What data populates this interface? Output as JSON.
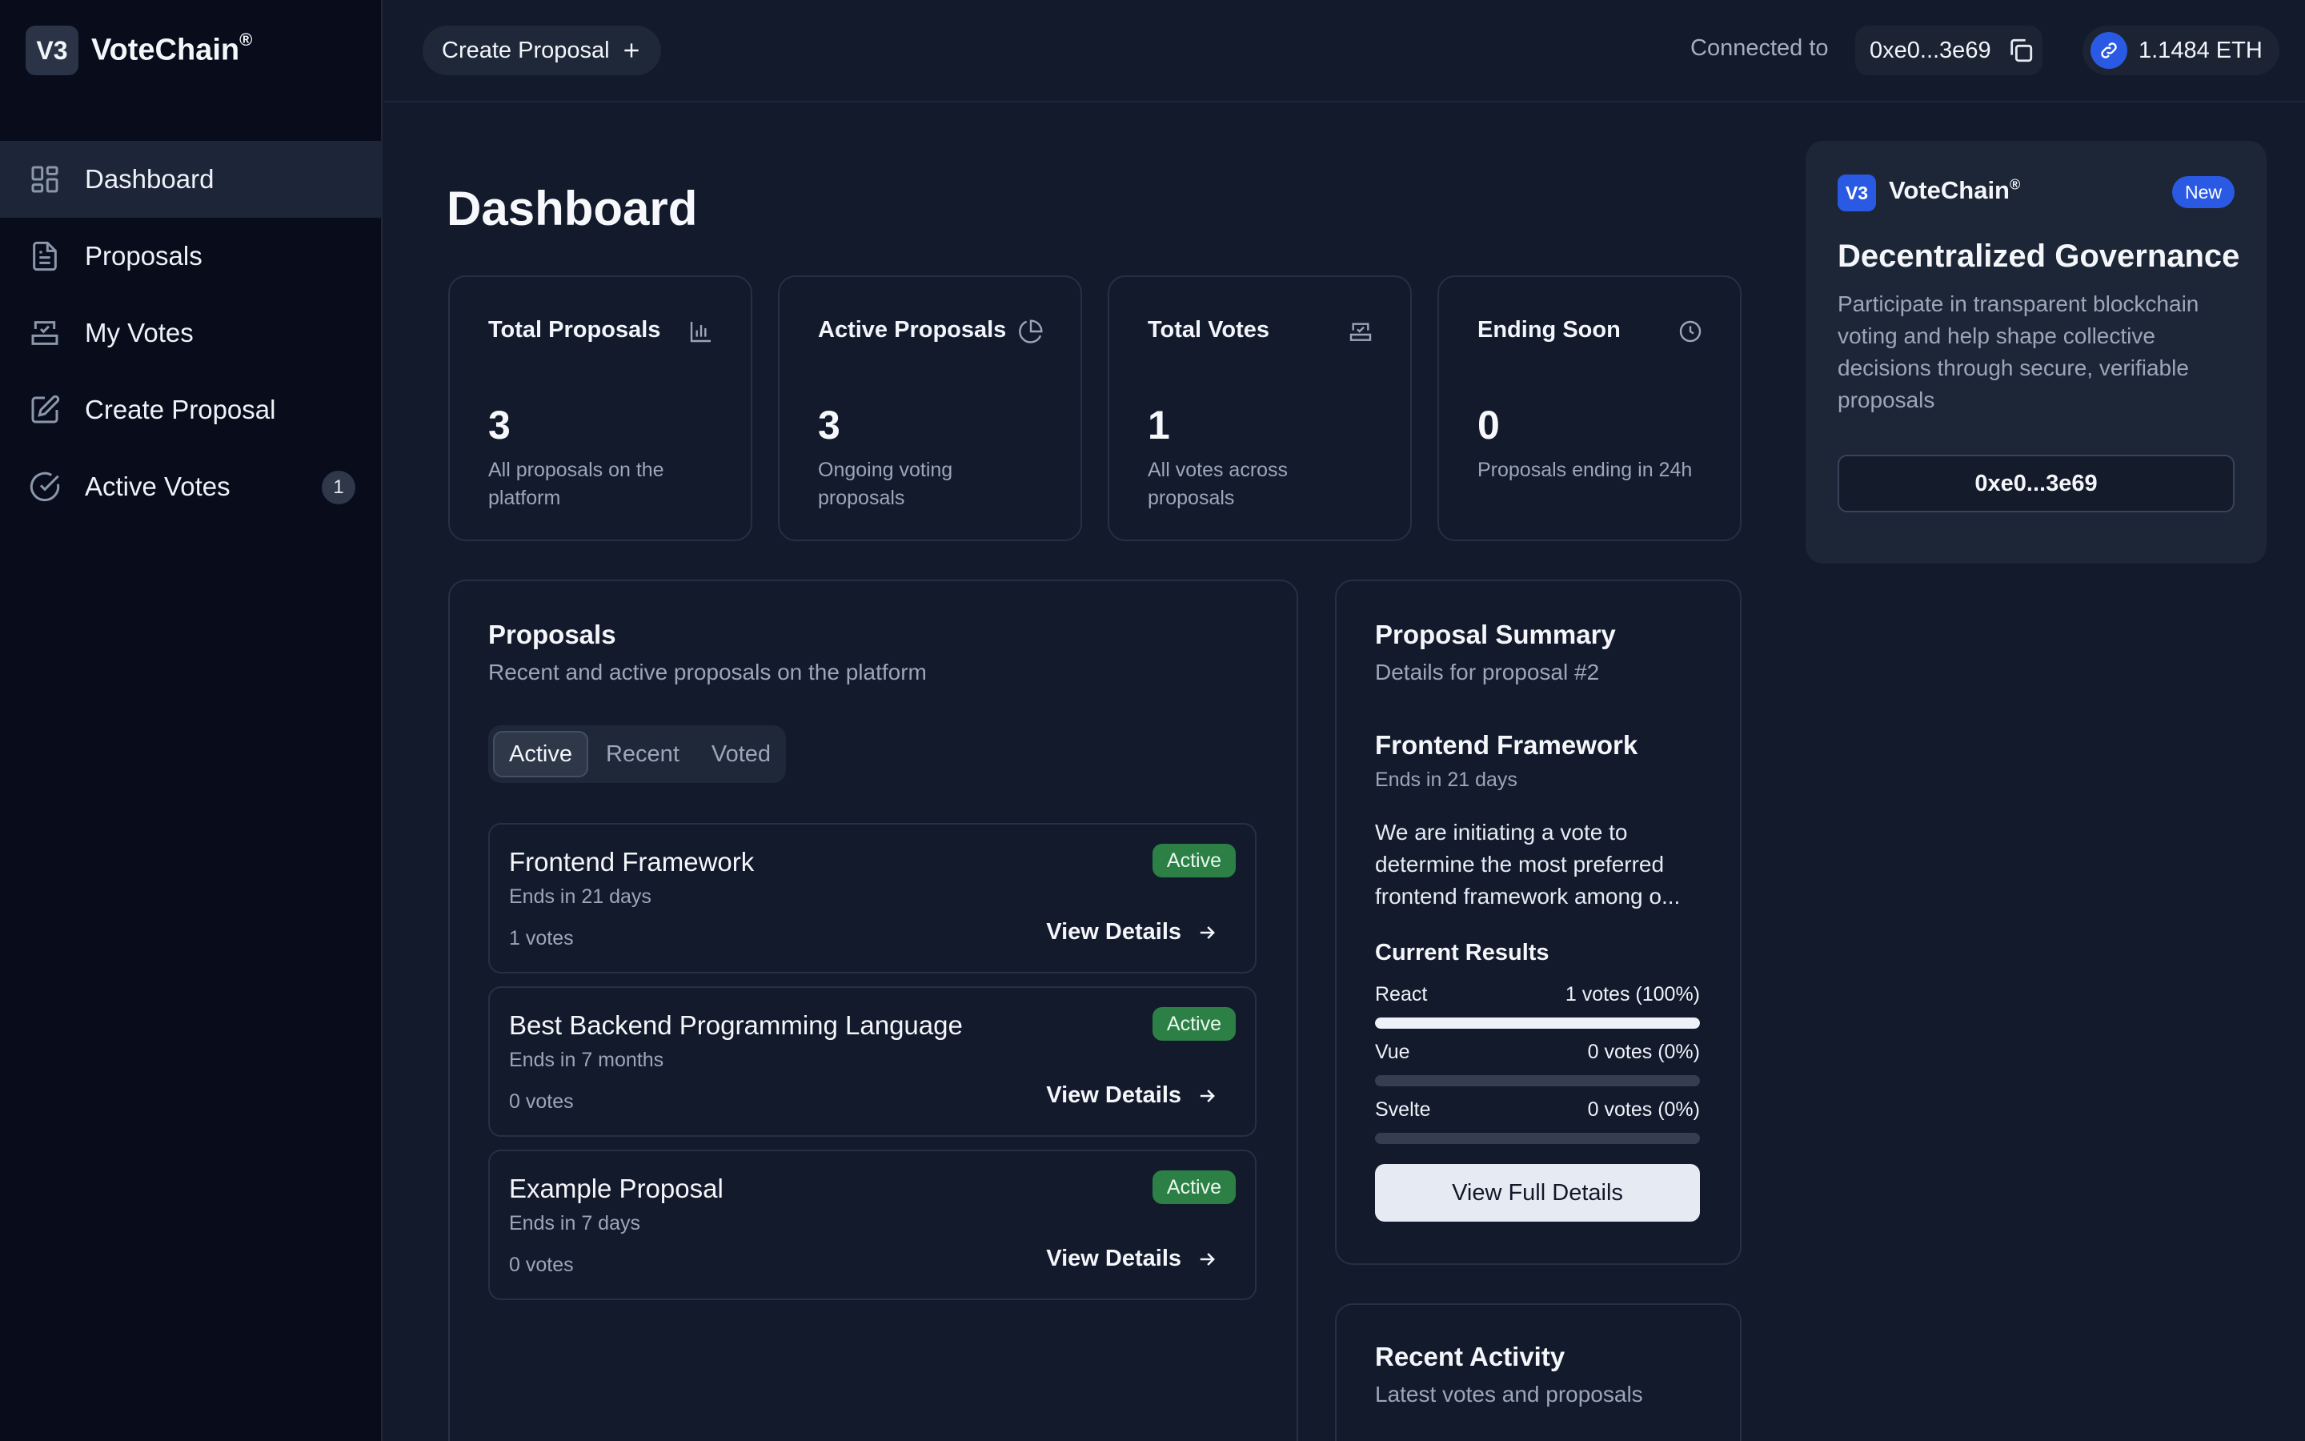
{
  "brand": {
    "mark": "V3",
    "name": "VoteChain",
    "reg": "®"
  },
  "sidebar": {
    "items": [
      {
        "label": "Dashboard",
        "icon": "dashboard-icon",
        "active": true
      },
      {
        "label": "Proposals",
        "icon": "document-icon"
      },
      {
        "label": "My Votes",
        "icon": "ballot-box-icon"
      },
      {
        "label": "Create Proposal",
        "icon": "edit-icon"
      },
      {
        "label": "Active Votes",
        "icon": "check-circle-icon",
        "badge": "1"
      }
    ]
  },
  "topbar": {
    "create_label": "Create Proposal",
    "connected_label": "Connected to",
    "address": "0xe0...3e69",
    "balance": "1.1484 ETH"
  },
  "page": {
    "title": "Dashboard"
  },
  "stats": [
    {
      "title": "Total Proposals",
      "value": "3",
      "desc": "All proposals on the platform",
      "icon": "bar-chart-icon"
    },
    {
      "title": "Active Proposals",
      "value": "3",
      "desc": "Ongoing voting proposals",
      "icon": "pie-chart-icon"
    },
    {
      "title": "Total Votes",
      "value": "1",
      "desc": "All votes across proposals",
      "icon": "ballot-box-icon"
    },
    {
      "title": "Ending Soon",
      "value": "0",
      "desc": "Proposals ending in 24h",
      "icon": "clock-icon"
    }
  ],
  "proposals_panel": {
    "title": "Proposals",
    "subtitle": "Recent and active proposals on the platform",
    "tabs": [
      "Active",
      "Recent",
      "Voted"
    ],
    "active_tab": "Active",
    "items": [
      {
        "title": "Frontend Framework",
        "ends": "Ends in 21 days",
        "votes": "1 votes",
        "status": "Active",
        "link": "View Details"
      },
      {
        "title": "Best Backend Programming Language",
        "ends": "Ends in 7 months",
        "votes": "0 votes",
        "status": "Active",
        "link": "View Details"
      },
      {
        "title": "Example Proposal",
        "ends": "Ends in 7 days",
        "votes": "0 votes",
        "status": "Active",
        "link": "View Details"
      }
    ]
  },
  "summary": {
    "title": "Proposal Summary",
    "subtitle": "Details for proposal #2",
    "proposal_title": "Frontend Framework",
    "ends": "Ends in 21 days",
    "description": "We are initiating a vote to determine the most preferred frontend framework among o...",
    "results_title": "Current Results",
    "results": [
      {
        "option": "React",
        "label": "1 votes (100%)",
        "percent": 100
      },
      {
        "option": "Vue",
        "label": "0 votes (0%)",
        "percent": 0
      },
      {
        "option": "Svelte",
        "label": "0 votes (0%)",
        "percent": 0
      }
    ],
    "button": "View Full Details"
  },
  "activity": {
    "title": "Recent Activity",
    "subtitle": "Latest votes and proposals"
  },
  "promo": {
    "mark": "V3",
    "brand": "VoteChain",
    "reg": "®",
    "badge": "New",
    "title": "Decentralized Governance",
    "desc": "Participate in transparent blockchain voting and help shape collective decisions through secure, verifiable proposals",
    "address": "0xe0...3e69"
  },
  "colors": {
    "accent": "#2a5ae4",
    "status_active": "#2c8046",
    "background": "#121a2c",
    "sidebar": "#080c1b"
  }
}
